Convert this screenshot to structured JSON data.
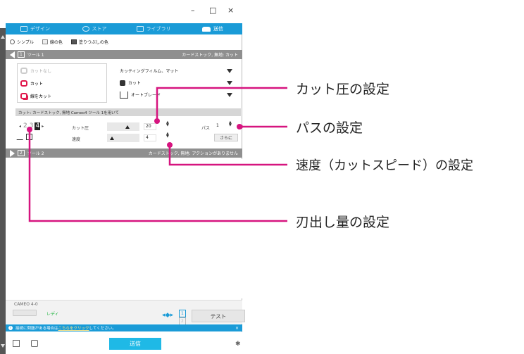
{
  "window": {
    "minimize": "–",
    "maximize": "□",
    "close": "×"
  },
  "tabs": [
    {
      "label": "デザイン",
      "icon": "grid-icon"
    },
    {
      "label": "ストア",
      "icon": "store-icon"
    },
    {
      "label": "ライブラリ",
      "icon": "library-icon"
    },
    {
      "label": "送信",
      "icon": "send-icon"
    }
  ],
  "modes": {
    "simple": "シンプル",
    "line_color": "線の色",
    "fill_color": "塗りつぶしの色"
  },
  "tool1": {
    "num": "1",
    "name": "ツール 1",
    "material": "カードストック, 無地: カット"
  },
  "tool2": {
    "num": "2",
    "name": "ツール 2",
    "material": "カードストック, 無地: アクションがありません"
  },
  "actions": {
    "none": "カットなし",
    "cut": "カット",
    "double": "線をカット"
  },
  "dropdowns": {
    "material": "カッティングフィルム、マット",
    "action": "カット",
    "tool": "オートブレード"
  },
  "condition_text": "カット: カードストック, 無地 Cameo4 ツール 1を用いて",
  "depth": {
    "arrow_left": "◂",
    "values": [
      "2",
      "3",
      "4"
    ],
    "arrow_right": "▸"
  },
  "force": {
    "label": "カット圧",
    "value": "20"
  },
  "speed": {
    "label": "速度",
    "value": "4"
  },
  "passes": {
    "label": "パス",
    "value": "1"
  },
  "more_button": "さらに",
  "status": {
    "model": "CAMEO 4-0",
    "ready": "レディ",
    "tool_nums": [
      "1",
      "2"
    ],
    "test_button": "テスト",
    "move_glyph": "◂◆▸"
  },
  "info": {
    "prefix": "接続に問題がある場合は",
    "link": "こちらをクリック",
    "suffix": "してください。",
    "close": "×",
    "icon": "i"
  },
  "send_button": "送信",
  "callouts": {
    "force": "カット圧の設定",
    "passes": "パスの設定",
    "speed": "速度（カットスピード）の設定",
    "depth": "刃出し量の設定"
  },
  "colors": {
    "accent": "#1a9bd7",
    "callout": "#d6147f",
    "ready": "#1bb33b",
    "cut": "#e0164a"
  }
}
